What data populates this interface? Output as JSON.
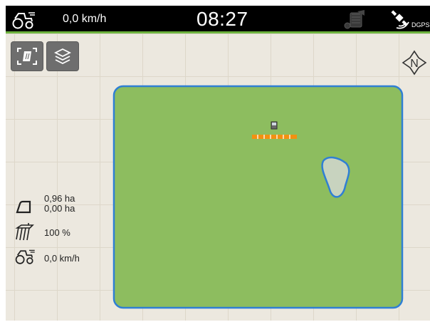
{
  "status_bar": {
    "speed": "0,0 km/h",
    "clock": "08:27",
    "gps_label": "DGPS",
    "icons": [
      "tractor-speed-icon",
      "camera-icon",
      "gps-satellite-icon"
    ]
  },
  "toolbar": {
    "icons": [
      "map-view-icon",
      "layers-icon"
    ]
  },
  "compass": {
    "label": "N"
  },
  "field_stats": {
    "area_total": "0,96 ha",
    "area_worked": "0,00 ha",
    "working_width": "100 %",
    "speed": "0,0 km/h"
  },
  "colors": {
    "field_fill": "#8dbd5f",
    "field_border": "#2f7fd4",
    "boom_section": "#f29111",
    "grid_line": "#ddd7c9",
    "map_background": "#ece8df",
    "status_accent": "#6db33f"
  }
}
